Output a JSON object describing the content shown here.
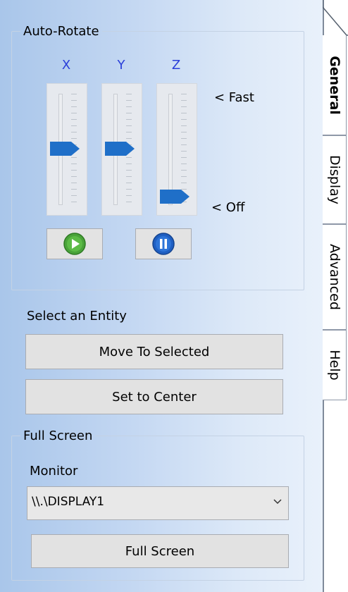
{
  "auto_rotate": {
    "title": "Auto-Rotate",
    "axes": [
      {
        "label": "X",
        "speed": 0.5
      },
      {
        "label": "Y",
        "speed": 0.5
      },
      {
        "label": "Z",
        "speed": 0.0
      }
    ],
    "fast_label": "< Fast",
    "off_label": "< Off",
    "play_icon": "play-icon",
    "pause_icon": "pause-icon"
  },
  "entity": {
    "title": "Select an Entity",
    "move_label": "Move To Selected",
    "center_label": "Set to Center"
  },
  "full_screen": {
    "title": "Full Screen",
    "monitor_label": "Monitor",
    "monitor_value": "\\\\.\\DISPLAY1",
    "button_label": "Full Screen"
  },
  "tabs": [
    {
      "label": "General",
      "active": true
    },
    {
      "label": "Display",
      "active": false
    },
    {
      "label": "Advanced",
      "active": false
    },
    {
      "label": "Help",
      "active": false
    }
  ],
  "colors": {
    "axis_label": "#2a3fd9",
    "thumb": "#1f6fc8",
    "play": "#4aa33a",
    "pause": "#1f5fc2"
  }
}
